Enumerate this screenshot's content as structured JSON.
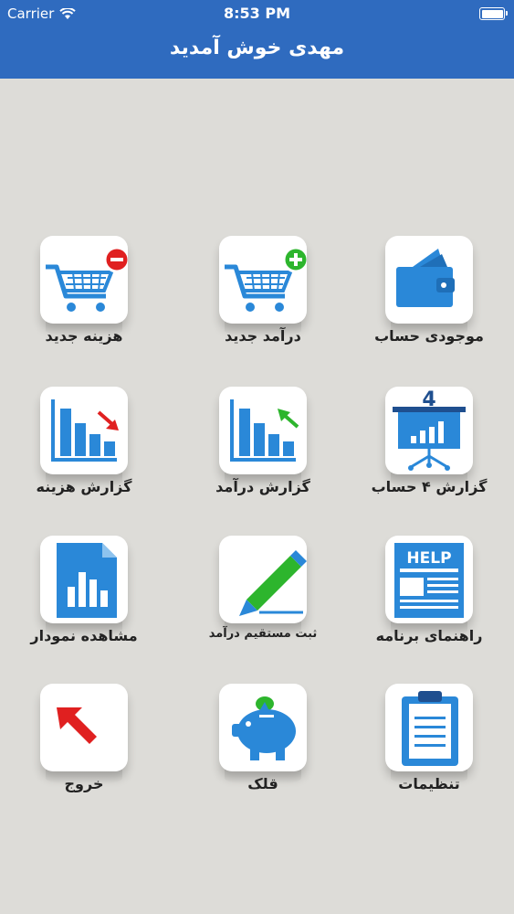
{
  "status": {
    "carrier": "Carrier",
    "time": "8:53 PM"
  },
  "header": {
    "title": "مهدی خوش آمدید"
  },
  "menu": [
    {
      "label": "موجودی حساب",
      "icon": "wallet-icon"
    },
    {
      "label": "درآمد جدید",
      "icon": "cart-add-icon"
    },
    {
      "label": "هزینه جدید",
      "icon": "cart-remove-icon"
    },
    {
      "label": "گزارش ۴ حساب",
      "icon": "presentation-chart-icon"
    },
    {
      "label": "گزارش درآمد",
      "icon": "bar-chart-up-icon"
    },
    {
      "label": "گزارش هزینه",
      "icon": "bar-chart-down-icon"
    },
    {
      "label": "راهنمای برنامه",
      "icon": "help-document-icon"
    },
    {
      "label": "ثبت مستقیم درآمد",
      "icon": "pencil-icon"
    },
    {
      "label": "مشاهده نمودار",
      "icon": "chart-document-icon"
    },
    {
      "label": "تنظیمات",
      "icon": "clipboard-icon"
    },
    {
      "label": "قلک",
      "icon": "piggy-bank-icon"
    },
    {
      "label": "خروج",
      "icon": "exit-arrow-icon"
    }
  ],
  "icon_text": {
    "help": "HELP",
    "four": "4"
  },
  "colors": {
    "header": "#2f6bbf",
    "icon_blue": "#2a88d8",
    "green": "#2db52d",
    "red": "#e02020"
  }
}
